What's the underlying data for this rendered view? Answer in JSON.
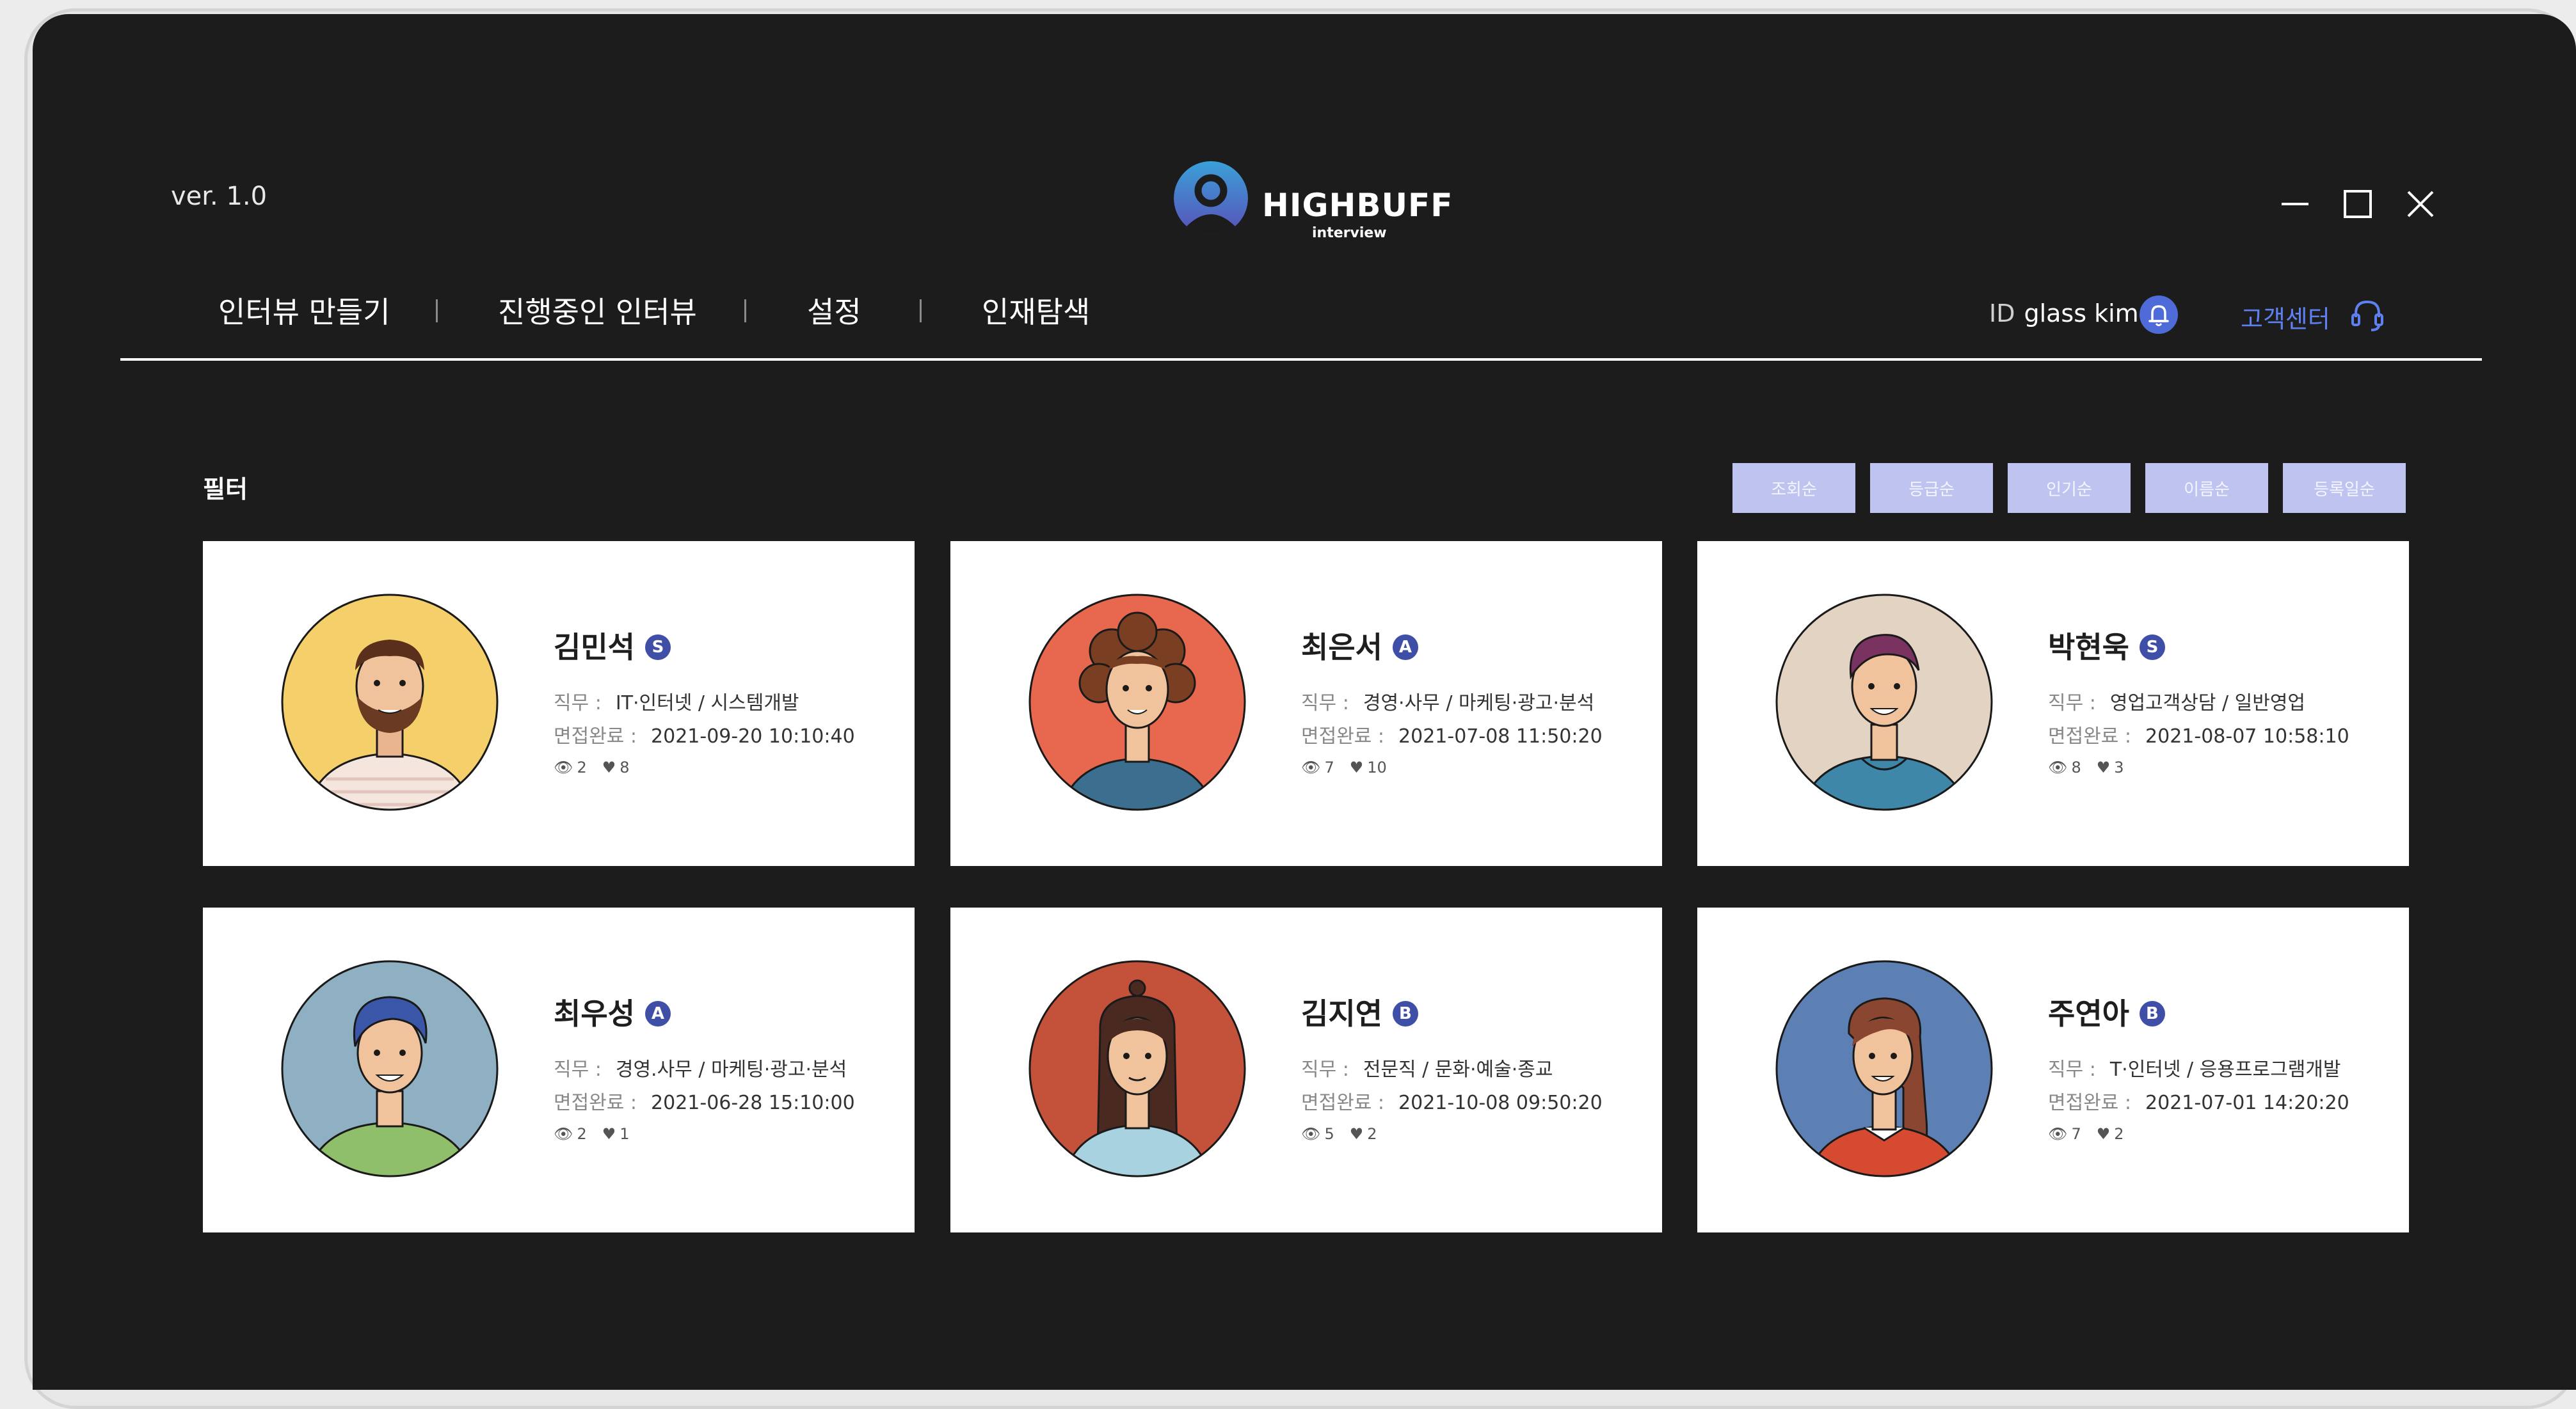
{
  "app": {
    "version": "ver. 1.0",
    "logo_word": "HIGHBUFF",
    "logo_sub": "interview"
  },
  "nav": {
    "items": [
      "인터뷰 만들기",
      "진행중인 인터뷰",
      "설정",
      "인재탐색"
    ],
    "user_label": "ID",
    "user_name": "glass kim",
    "support": "고객센터"
  },
  "filter": {
    "label": "필터",
    "sort_buttons": [
      "조회순",
      "등급순",
      "인기순",
      "이름순",
      "등록일순"
    ]
  },
  "labels": {
    "job": "직무 :",
    "done": "면접완료 :"
  },
  "colors": {
    "background": "#1c1c1d",
    "accent": "#4e6bd8",
    "sort_button": "#bec4ef",
    "grade_badge": "#3f4fa8"
  },
  "candidates": [
    {
      "name": "김민석",
      "grade": "S",
      "job": "IT·인터넷 / 시스템개발",
      "date": "2021-09-20 10:10:40",
      "views": "2",
      "likes": "8"
    },
    {
      "name": "최은서",
      "grade": "A",
      "job": "경영·사무 / 마케팅·광고·분석",
      "date": "2021-07-08 11:50:20",
      "views": "7",
      "likes": "10"
    },
    {
      "name": "박현욱",
      "grade": "S",
      "job": "영업고객상담 / 일반영업",
      "date": "2021-08-07 10:58:10",
      "views": "8",
      "likes": "3"
    },
    {
      "name": "최우성",
      "grade": "A",
      "job": "경영.사무 / 마케팅·광고·분석",
      "date": "2021-06-28 15:10:00",
      "views": "2",
      "likes": "1"
    },
    {
      "name": "김지연",
      "grade": "B",
      "job": "전문직 / 문화·예술·종교",
      "date": "2021-10-08 09:50:20",
      "views": "5",
      "likes": "2"
    },
    {
      "name": "주연아",
      "grade": "B",
      "job": "T·인터넷 / 응용프로그램개발",
      "date": "2021-07-01 14:20:20",
      "views": "7",
      "likes": "2"
    }
  ]
}
